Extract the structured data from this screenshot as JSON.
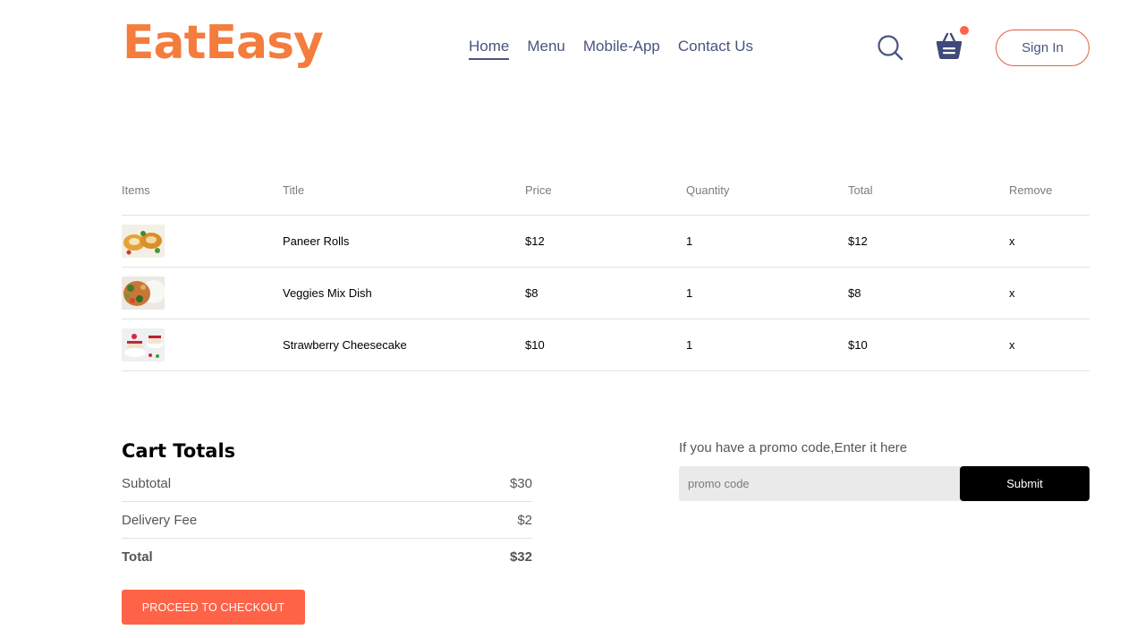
{
  "brand": {
    "logo_text": "EatEasy",
    "color": "#f47c3c"
  },
  "nav": {
    "items": [
      "Home",
      "Menu",
      "Mobile-App",
      "Contact Us"
    ],
    "active": "Home"
  },
  "header": {
    "signin_label": "Sign In",
    "search_icon": "search-icon",
    "basket_icon": "basket-icon"
  },
  "cart": {
    "columns": [
      "Items",
      "Title",
      "Price",
      "Quantity",
      "Total",
      "Remove"
    ],
    "rows": [
      {
        "title": "Paneer Rolls",
        "price": "$12",
        "quantity": "1",
        "total": "$12",
        "remove": "x"
      },
      {
        "title": "Veggies Mix Dish",
        "price": "$8",
        "quantity": "1",
        "total": "$8",
        "remove": "x"
      },
      {
        "title": "Strawberry Cheesecake",
        "price": "$10",
        "quantity": "1",
        "total": "$10",
        "remove": "x"
      }
    ]
  },
  "totals": {
    "heading": "Cart Totals",
    "subtotal_label": "Subtotal",
    "subtotal_value": "$30",
    "delivery_label": "Delivery Fee",
    "delivery_value": "$2",
    "total_label": "Total",
    "total_value": "$32",
    "checkout_label": "PROCEED TO CHECKOUT"
  },
  "promo": {
    "label": "If you have a promo code,Enter it here",
    "placeholder": "promo code",
    "submit_label": "Submit"
  },
  "colors": {
    "accent": "#ff6347",
    "text": "#49557e"
  }
}
